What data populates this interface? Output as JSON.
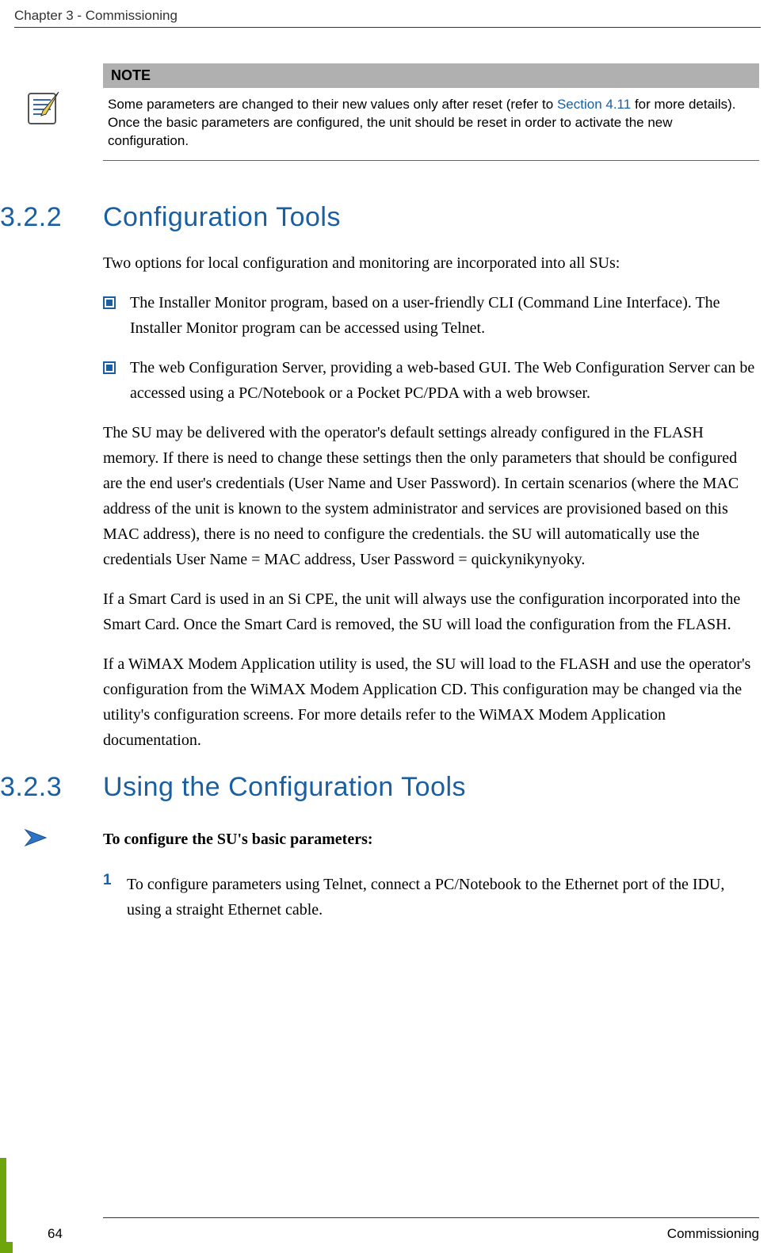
{
  "header": {
    "chapterLine": "Chapter 3 - Commissioning"
  },
  "note": {
    "label": "NOTE",
    "preLink": "Some parameters are changed to their new values only after reset (refer to ",
    "linkText": "Section 4.11",
    "postLink": " for more details). Once the basic parameters are configured, the unit should be reset in order to activate the new configuration."
  },
  "sections": {
    "s322": {
      "number": "3.2.2",
      "title": "Configuration Tools",
      "intro": "Two options for local configuration and monitoring are incorporated into all SUs:",
      "bullets": [
        "The Installer Monitor program, based on a user-friendly CLI (Command Line Interface). The Installer Monitor program can be accessed using Telnet.",
        "The web Configuration Server, providing a web-based GUI. The Web Configuration Server can be accessed using a PC/Notebook or a Pocket PC/PDA with a web browser."
      ],
      "paras": [
        "The SU may be delivered with the operator's default settings already configured in the FLASH memory. If there is need to change these settings then the only parameters that should be configured are the end user's credentials (User Name and User Password). In certain scenarios (where the MAC address of the unit is known to the system administrator and services are provisioned based on this MAC address), there is no need to configure the credentials. the SU will automatically use the credentials User Name = MAC address, User Password = quickynikynyoky.",
        "If a Smart Card is used in an Si CPE, the unit will always use the configuration incorporated into the Smart Card. Once the Smart Card is removed, the SU will load the configuration from the FLASH.",
        "If a WiMAX Modem Application utility is used, the SU will load to the FLASH and use the operator's configuration from the WiMAX Modem Application CD. This configuration may be changed via the utility's configuration screens. For more details refer to the WiMAX Modem Application documentation."
      ]
    },
    "s323": {
      "number": "3.2.3",
      "title": "Using the Configuration Tools",
      "procTitle": "To configure the SU's basic parameters:",
      "steps": [
        {
          "num": "1",
          "text": "To configure parameters using Telnet, connect a PC/Notebook to the Ethernet port of the IDU, using a straight Ethernet cable."
        }
      ]
    }
  },
  "footer": {
    "pageNumber": "64",
    "section": "Commissioning"
  }
}
